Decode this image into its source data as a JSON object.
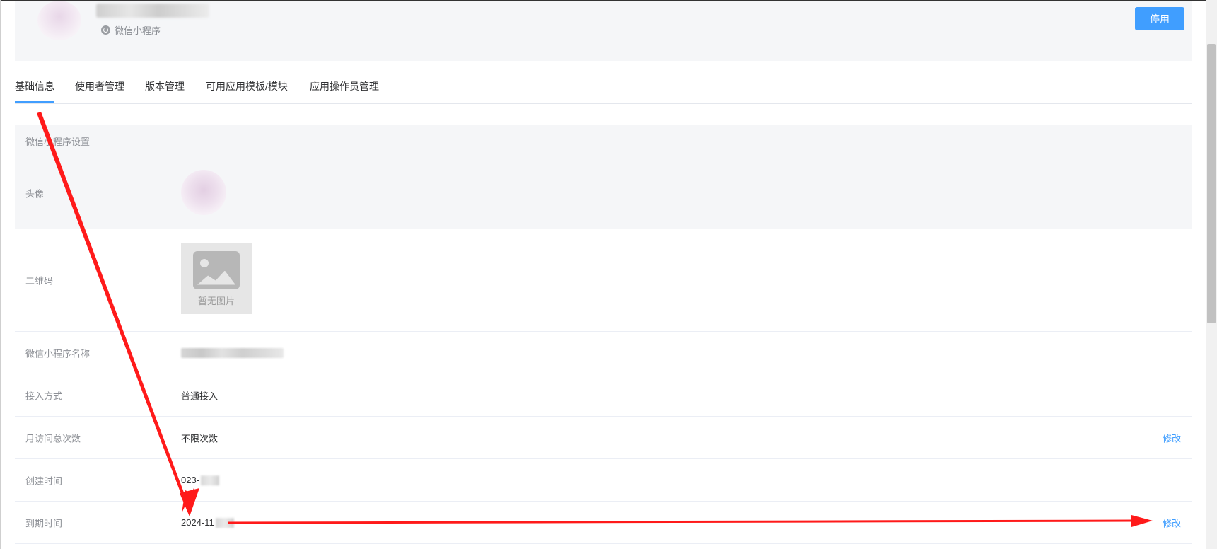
{
  "header": {
    "app_type": "微信小程序",
    "disable_button": "停用"
  },
  "tabs": [
    {
      "label": "基础信息",
      "active": true
    },
    {
      "label": "使用者管理",
      "active": false
    },
    {
      "label": "版本管理",
      "active": false
    },
    {
      "label": "可用应用模板/模块",
      "active": false
    },
    {
      "label": "应用操作员管理",
      "active": false
    }
  ],
  "settings": {
    "section_title": "微信小程序设置",
    "rows": {
      "avatar": {
        "label": "头像"
      },
      "qrcode": {
        "label": "二维码",
        "placeholder": "暂无图片"
      },
      "name": {
        "label": "微信小程序名称"
      },
      "access": {
        "label": "接入方式",
        "value": "普通接入"
      },
      "monthly_visits": {
        "label": "月访问总次数",
        "value": "不限次数",
        "action": "修改"
      },
      "created": {
        "label": "创建时间",
        "value": "023-"
      },
      "expires": {
        "label": "到期时间",
        "value": "2024-11",
        "action": "修改"
      }
    }
  },
  "colors": {
    "accent": "#409eff",
    "annotation": "#ff1a1a"
  },
  "icons": [
    "mini-program-icon",
    "image-placeholder-icon"
  ]
}
